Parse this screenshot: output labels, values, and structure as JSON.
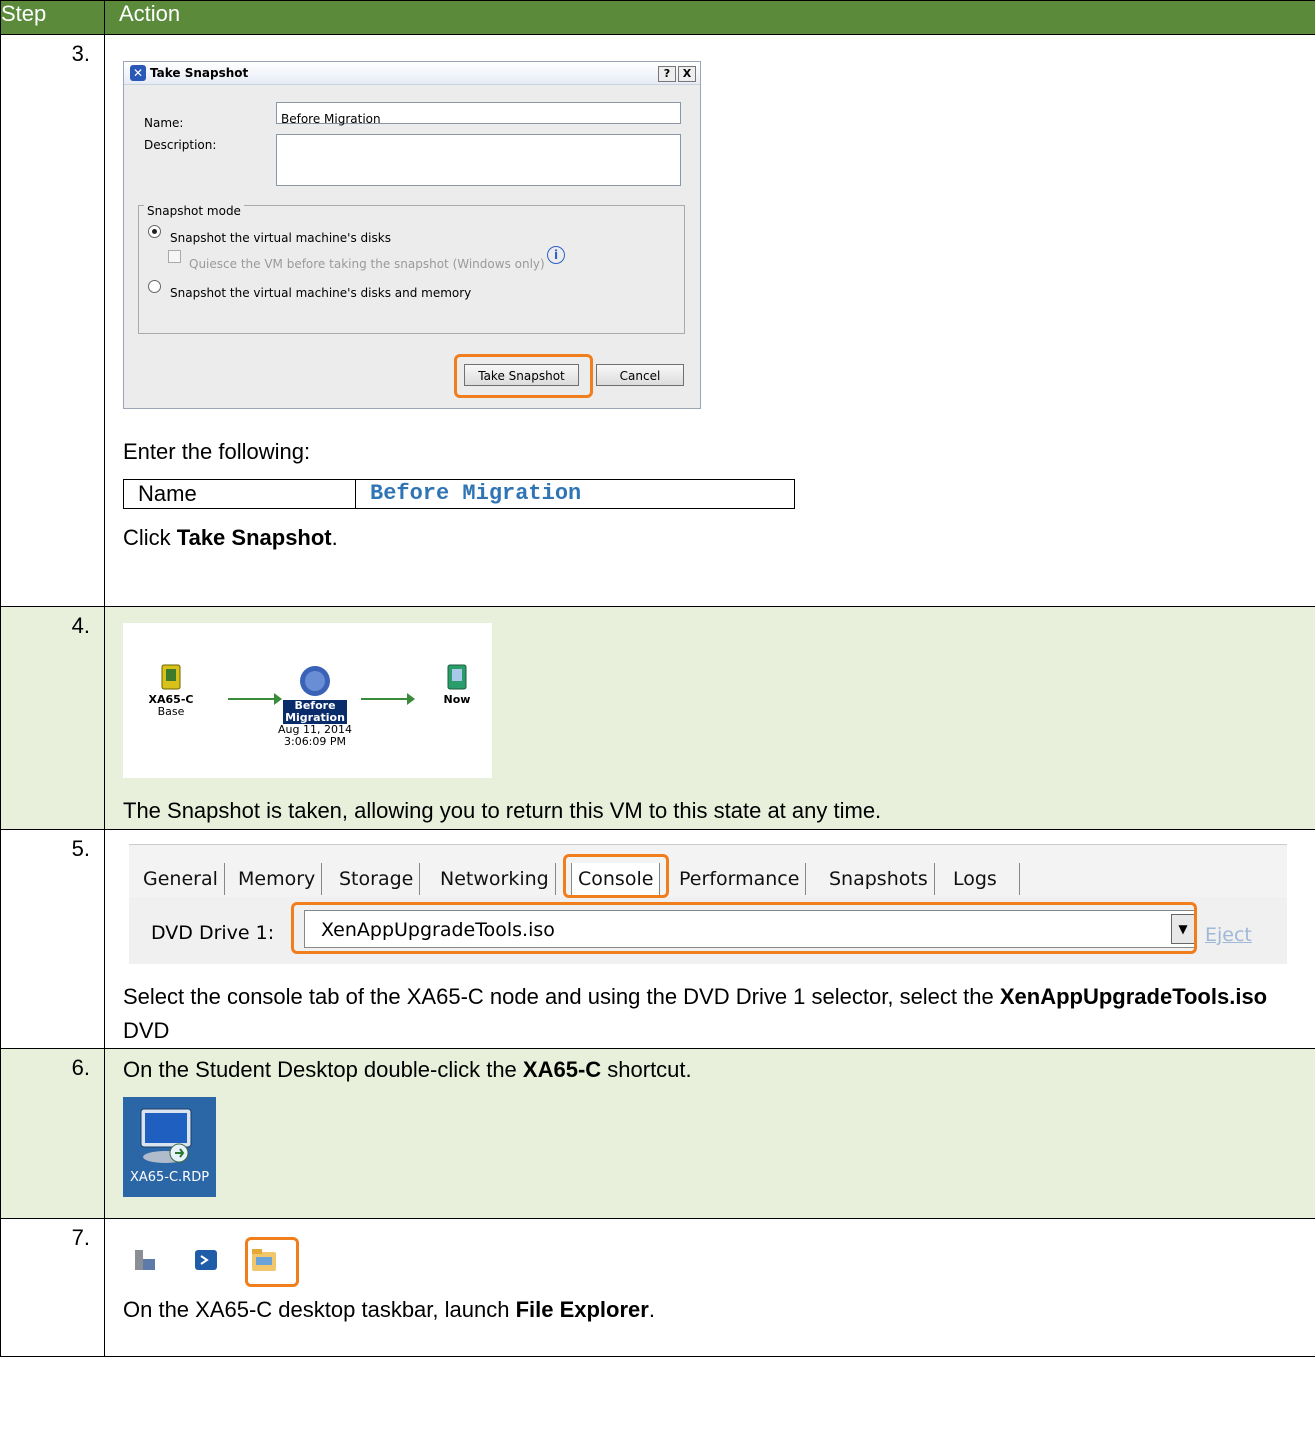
{
  "header": {
    "step": "Step",
    "action": "Action"
  },
  "step3": {
    "num": "3.",
    "dialog": {
      "title": "Take Snapshot",
      "help_btn": "?",
      "close_btn": "X",
      "name_label": "Name:",
      "name_value": "Before Migration",
      "description_label": "Description:",
      "group_title": "Snapshot mode",
      "opt_disks": "Snapshot the virtual machine's disks",
      "opt_quiesce": "Quiesce the VM before taking the snapshot (Windows only)",
      "opt_memory": "Snapshot the virtual machine's disks and memory",
      "take_btn": "Take Snapshot",
      "cancel_btn": "Cancel"
    },
    "intro": "Enter the following:",
    "entry_label": "Name",
    "entry_value": "Before Migration",
    "click_prefix": "Click ",
    "click_bold": "Take Snapshot",
    "click_suffix": "."
  },
  "step4": {
    "num": "4.",
    "tree": {
      "node1_name": "XA65-C",
      "node1_sub": "Base",
      "node2_name_1": "Before",
      "node2_name_2": "Migration",
      "node2_date_1": "Aug 11, 2014",
      "node2_date_2": "3:06:09 PM",
      "node3_name": "Now"
    },
    "text": "The Snapshot is taken, allowing you to return this VM to this state at any time."
  },
  "step5": {
    "num": "5.",
    "tabs": [
      "General",
      "Memory",
      "Storage",
      "Networking",
      "Console",
      "Performance",
      "Snapshots",
      "Logs"
    ],
    "dvd_label": "DVD Drive 1:",
    "dvd_value": "XenAppUpgradeTools.iso",
    "eject": "Eject",
    "text_1": "Select the console tab of the XA65-C node and using the DVD Drive 1 selector, select the ",
    "text_bold": "XenAppUpgradeTools.iso",
    "text_2": " DVD"
  },
  "step6": {
    "num": "6.",
    "text_1": "On the Student Desktop double-click the ",
    "text_bold": "XA65-C",
    "text_2": " shortcut.",
    "icon_label": "XA65-C.RDP"
  },
  "step7": {
    "num": "7.",
    "text_1": "On the XA65-C desktop taskbar, launch ",
    "text_bold": "File Explorer",
    "text_2": "."
  }
}
